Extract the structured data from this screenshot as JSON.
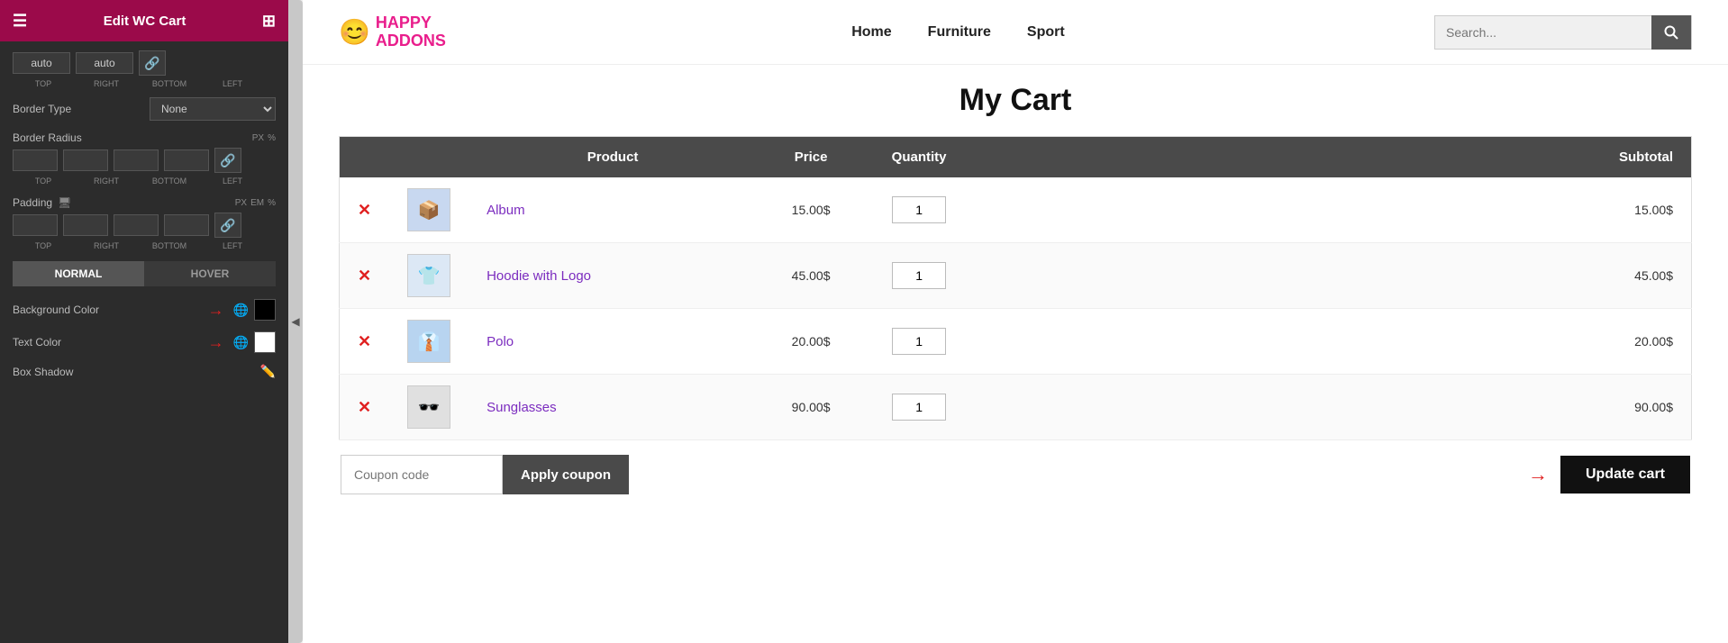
{
  "leftPanel": {
    "title": "Edit WC Cart",
    "positionInputs": {
      "top": "auto",
      "right": "auto",
      "subLabels": [
        "TOP",
        "RIGHT",
        "BOTTOM",
        "LEFT"
      ]
    },
    "borderType": {
      "label": "Border Type",
      "value": "None"
    },
    "borderRadius": {
      "label": "Border Radius",
      "units": [
        "PX",
        "%"
      ]
    },
    "padding": {
      "label": "Padding",
      "units": [
        "PX",
        "EM",
        "%"
      ]
    },
    "normalLabel": "NORMAL",
    "hoverLabel": "HOVER",
    "backgroundColor": {
      "label": "Background Color",
      "color": "#000000"
    },
    "textColor": {
      "label": "Text Color",
      "color": "#ffffff"
    },
    "boxShadow": {
      "label": "Box Shadow"
    }
  },
  "topNav": {
    "logoEmoji": "😊",
    "logoHappy": "HAPPY",
    "logoAddons": "ADDONS",
    "links": [
      {
        "label": "Home"
      },
      {
        "label": "Furniture"
      },
      {
        "label": "Sport"
      }
    ],
    "searchPlaceholder": "Search..."
  },
  "pageTitle": "My Cart",
  "cartTable": {
    "headers": [
      {
        "label": "",
        "key": "remove"
      },
      {
        "label": "",
        "key": "thumb"
      },
      {
        "label": "Product",
        "key": "product"
      },
      {
        "label": "Price",
        "key": "price"
      },
      {
        "label": "Quantity",
        "key": "quantity"
      },
      {
        "label": "Subtotal",
        "key": "subtotal"
      }
    ],
    "rows": [
      {
        "id": 1,
        "thumbEmoji": "📦",
        "thumbBg": "#c8d8f0",
        "name": "Album",
        "price": "15.00$",
        "quantity": "1",
        "subtotal": "15.00$"
      },
      {
        "id": 2,
        "thumbEmoji": "👕",
        "thumbBg": "#dce8f5",
        "name": "Hoodie with Logo",
        "price": "45.00$",
        "quantity": "1",
        "subtotal": "45.00$"
      },
      {
        "id": 3,
        "thumbEmoji": "👔",
        "thumbBg": "#b8d4f0",
        "name": "Polo",
        "price": "20.00$",
        "quantity": "1",
        "subtotal": "20.00$"
      },
      {
        "id": 4,
        "thumbEmoji": "🕶️",
        "thumbBg": "#e0e0e0",
        "name": "Sunglasses",
        "price": "90.00$",
        "quantity": "1",
        "subtotal": "90.00$"
      }
    ]
  },
  "cartActions": {
    "couponPlaceholder": "Coupon code",
    "applyCouponLabel": "Apply coupon",
    "updateCartLabel": "Update cart"
  }
}
